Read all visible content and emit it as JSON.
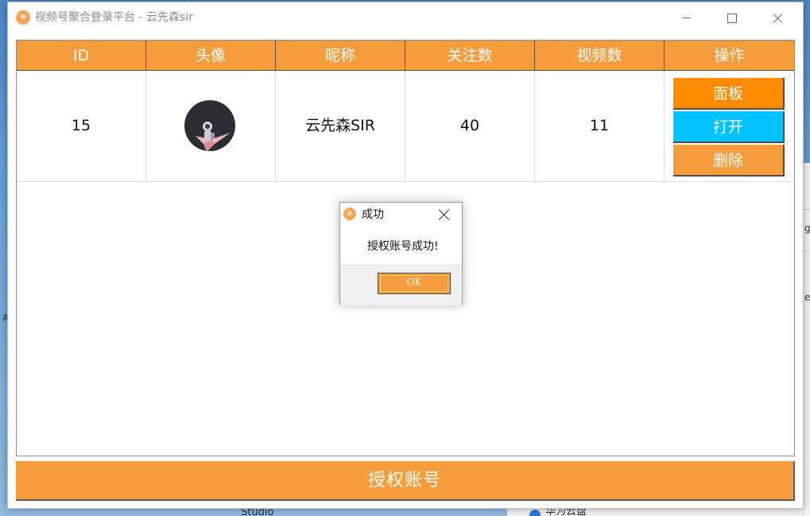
{
  "window": {
    "title": "视频号聚合登录平台 - 云先森sir",
    "app_icon": "app-logo-icon"
  },
  "table": {
    "headers": [
      "ID",
      "头像",
      "昵称",
      "关注数",
      "视频数",
      "操作"
    ],
    "rows": [
      {
        "id": "15",
        "avatar": "astronaut-avatar",
        "nickname": "云先森SIR",
        "follow_count": "40",
        "video_count": "11",
        "actions": {
          "panel_label": "面板",
          "open_label": "打开",
          "delete_label": "删除"
        }
      }
    ]
  },
  "footer": {
    "authorize_label": "授权账号"
  },
  "dialog": {
    "title": "成功",
    "message": "授权账号成功!",
    "ok_label": "OK"
  },
  "desktop": {
    "left_text": "A",
    "studio_text": "Studio",
    "bottom_text": "华为云盘",
    "right_chars": [
      "g",
      "e"
    ]
  },
  "colors": {
    "header_orange": "#f59d3d",
    "panel_button": "#ff8c00",
    "open_button": "#00c3ff",
    "delete_button": "#f59d3d",
    "authorize_button": "#f59d3d"
  }
}
